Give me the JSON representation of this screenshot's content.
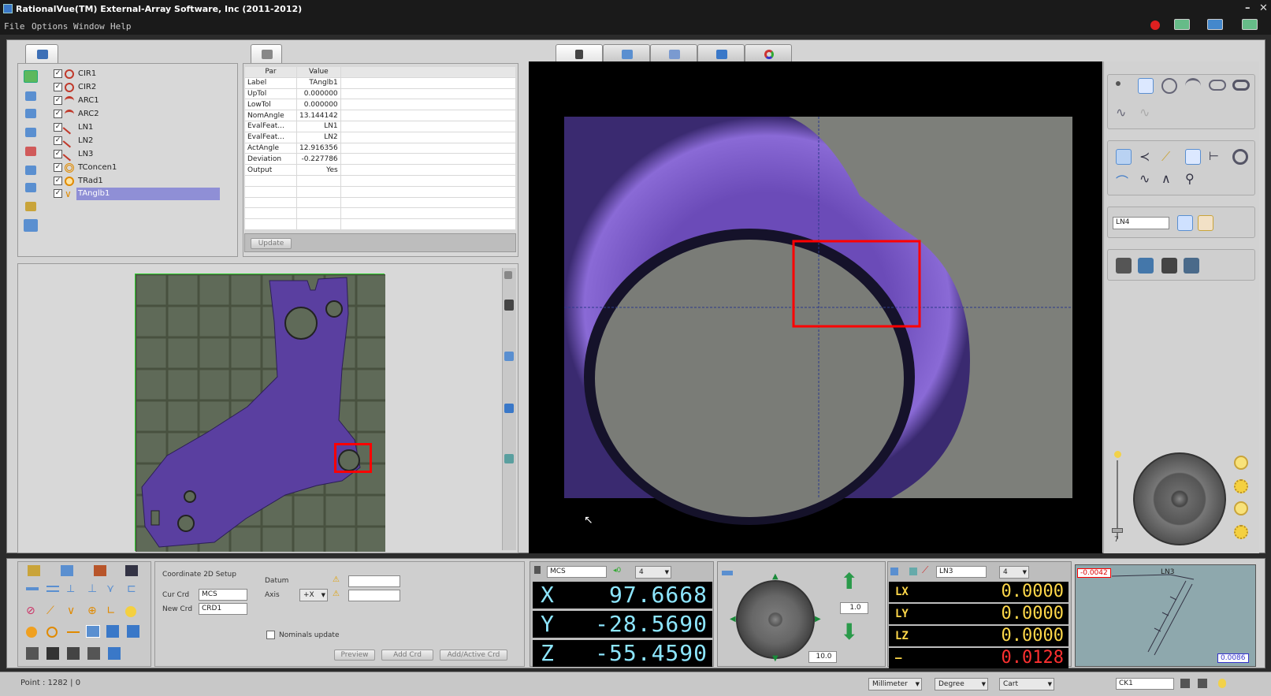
{
  "window": {
    "title": "RationalVue(TM) External-Array Software, Inc (2011-2012)"
  },
  "menu": [
    "File",
    "Options",
    "Window",
    "Help"
  ],
  "tree": {
    "items": [
      {
        "label": "CIR1",
        "icon": "circle-feature-icon",
        "color": "#c0392b"
      },
      {
        "label": "CIR2",
        "icon": "circle-feature-icon",
        "color": "#c0392b"
      },
      {
        "label": "ARC1",
        "icon": "arc-feature-icon",
        "color": "#c0392b"
      },
      {
        "label": "ARC2",
        "icon": "arc-feature-icon",
        "color": "#c0392b"
      },
      {
        "label": "LN1",
        "icon": "line-feature-icon",
        "color": "#c0392b"
      },
      {
        "label": "LN2",
        "icon": "line-feature-icon",
        "color": "#c0392b"
      },
      {
        "label": "LN3",
        "icon": "line-feature-icon",
        "color": "#c0392b"
      },
      {
        "label": "TConcen1",
        "icon": "concentric-tol-icon",
        "color": "#e08a00"
      },
      {
        "label": "TRad1",
        "icon": "radius-tol-icon",
        "color": "#e08a00"
      },
      {
        "label": "TAnglb1",
        "icon": "angle-tol-icon",
        "color": "#e08a00"
      }
    ],
    "selected": "TAnglb1"
  },
  "params": {
    "headers": [
      "Par",
      "Value"
    ],
    "rows": [
      [
        "Label",
        "TAnglb1"
      ],
      [
        "UpTol",
        "0.000000"
      ],
      [
        "LowTol",
        "0.000000"
      ],
      [
        "NomAngle",
        "13.144142"
      ],
      [
        "EvalFeat...",
        "LN1"
      ],
      [
        "EvalFeat...",
        "LN2"
      ],
      [
        "ActAngle",
        "12.916356"
      ],
      [
        "Deviation",
        "-0.227786"
      ],
      [
        "Output",
        "Yes"
      ]
    ],
    "update_label": "Update"
  },
  "feature_name": "LN4",
  "setup": {
    "title": "Coordinate 2D Setup",
    "cur_crd_label": "Cur Crd",
    "cur_crd_value": "MCS",
    "new_crd_label": "New Crd",
    "new_crd_value": "CRD1",
    "datum_label": "Datum",
    "axis_label": "Axis",
    "axis_value": "+X",
    "nominals_label": "Nominals update",
    "preview_label": "Preview",
    "add_crd_label": "Add Crd",
    "add_active_label": "Add/Active Crd"
  },
  "dro": {
    "system": "MCS",
    "decimals": "4",
    "x_label": "X",
    "x": "97.6668",
    "y_label": "Y",
    "y": "-28.5690",
    "z_label": "Z",
    "z": "-55.4590"
  },
  "jog": {
    "step_small": "1.0",
    "step_large": "10.0"
  },
  "feature_dro": {
    "feature": "LN3",
    "decimals": "4",
    "rows": [
      {
        "axis": "LX",
        "value": "0.0000"
      },
      {
        "axis": "LY",
        "value": "0.0000"
      },
      {
        "axis": "LZ",
        "value": "0.0000"
      },
      {
        "axis": "—",
        "value": "0.0128"
      }
    ]
  },
  "mini_plot": {
    "top_left": "-0.0042",
    "label": "LN3",
    "bottom_right": "0.0086"
  },
  "status": {
    "point": "Point : 1282 | 0",
    "unit": "Millimeter",
    "angle": "Degree",
    "coord": "Cart",
    "crd": "CK1"
  },
  "light_slider_value": "7",
  "colors": {
    "accent_red": "#ff0000",
    "dro_cyan": "#8de6ff",
    "dro_yellow": "#ffd84a",
    "part_purple": "#5a3fa0"
  }
}
